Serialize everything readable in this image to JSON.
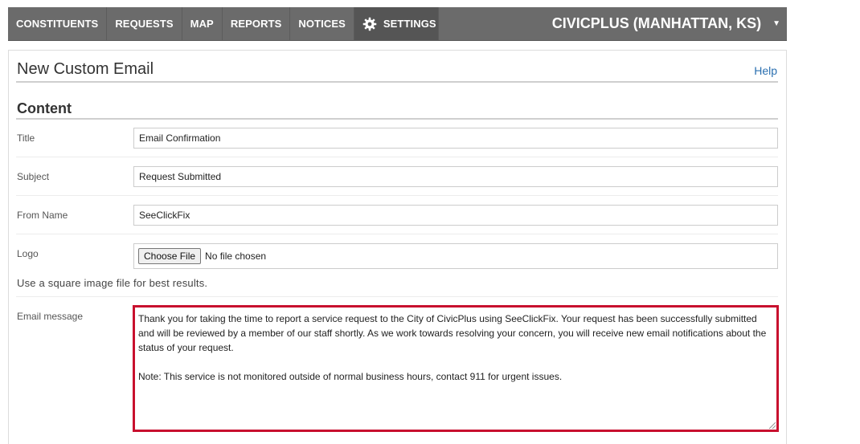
{
  "nav": {
    "items": [
      {
        "label": "CONSTITUENTS"
      },
      {
        "label": "REQUESTS"
      },
      {
        "label": "MAP"
      },
      {
        "label": "REPORTS"
      },
      {
        "label": "NOTICES"
      },
      {
        "label": "SETTINGS",
        "icon": "gear-icon",
        "active": true
      }
    ],
    "org": "CIVICPLUS (MANHATTAN, KS)",
    "org_icon": "caret-down-icon"
  },
  "page": {
    "title": "New Custom Email",
    "help": "Help",
    "section": "Content"
  },
  "form": {
    "title_label": "Title",
    "title_value": "Email Confirmation",
    "subject_label": "Subject",
    "subject_value": "Request Submitted",
    "from_label": "From Name",
    "from_value": "SeeClickFix",
    "logo_label": "Logo",
    "logo_button": "Choose File",
    "logo_status": "No file chosen",
    "logo_hint": "Use a square image file for best results.",
    "message_label": "Email message",
    "message_p1": "Thank you for taking the time to report a service request to the City of CivicPlus using SeeClickFix. Your request has been successfully submitted and will be reviewed by a member of our staff shortly. As we work towards resolving your concern, you will receive new email notifications about the status of your request.",
    "message_p2": "Note: This service is not monitored outside of normal business hours, contact 911 for urgent issues."
  },
  "colors": {
    "nav_bg": "#6b6b6b",
    "nav_active": "#555555",
    "link": "#2a6fb0",
    "highlight_border": "#c8102e"
  }
}
